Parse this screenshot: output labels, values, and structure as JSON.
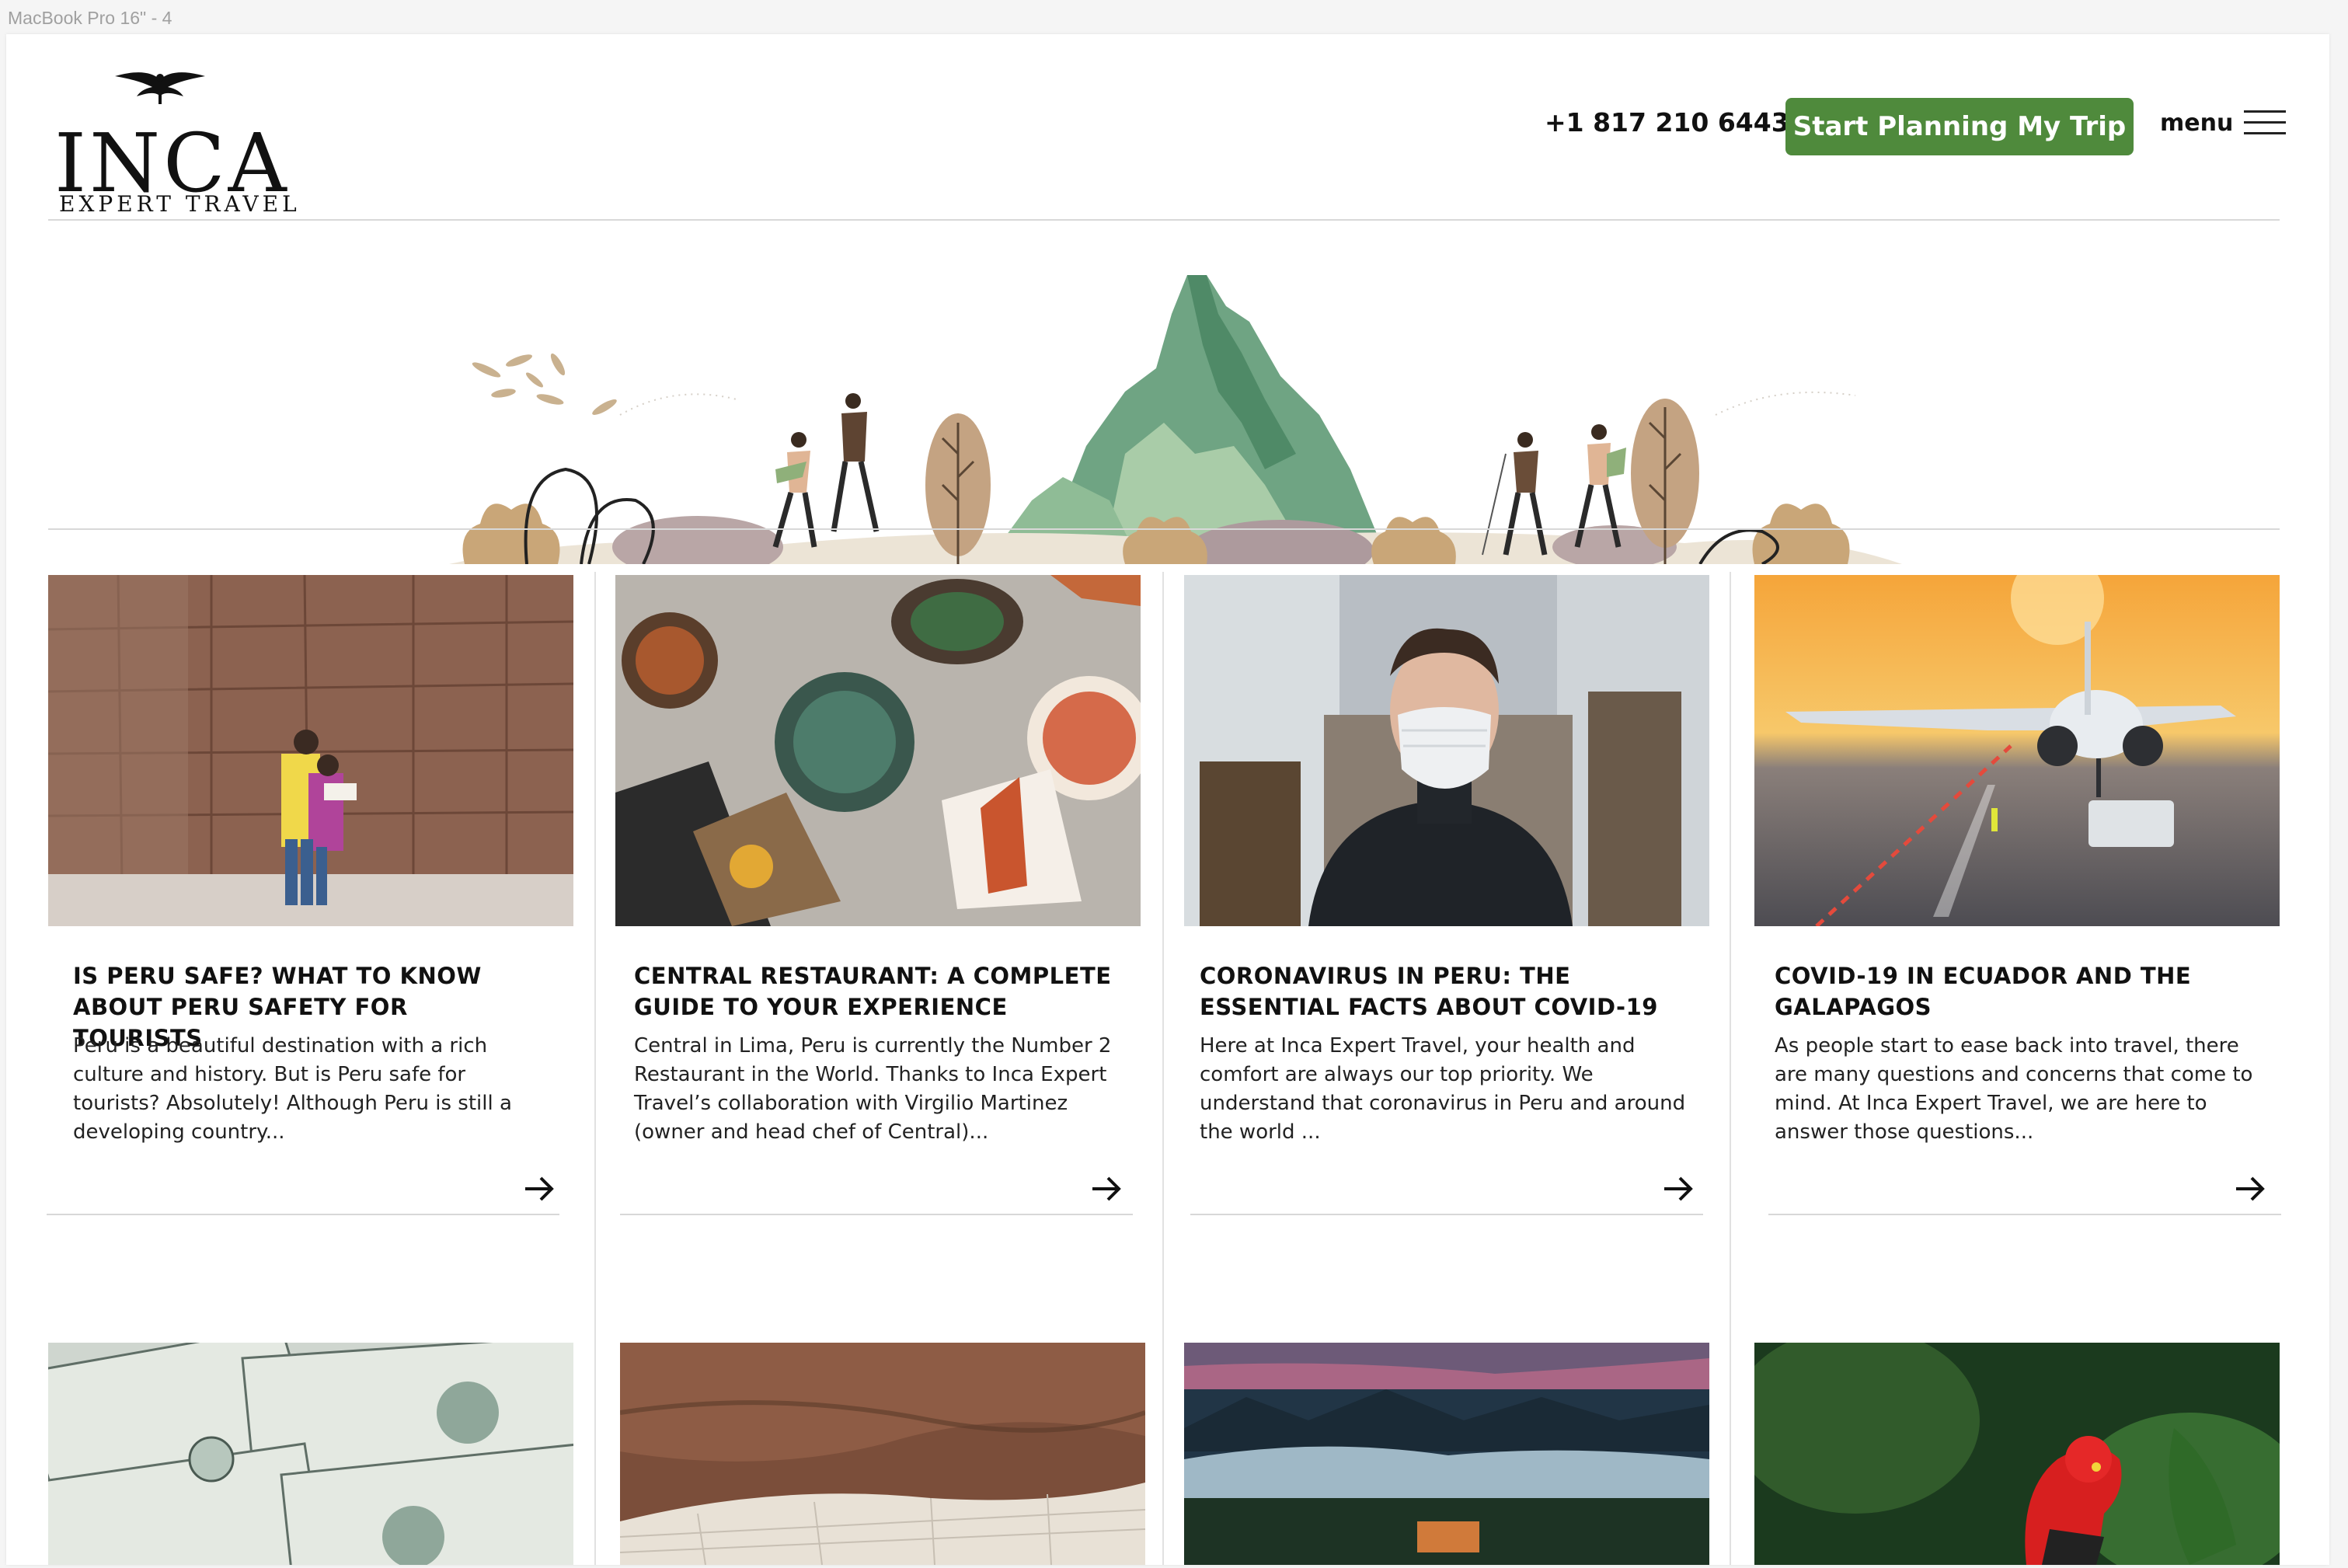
{
  "frame_label": "MacBook Pro 16\" - 4",
  "header": {
    "logo_word": "INCA",
    "logo_sub": "EXPERT TRAVEL",
    "phone": "+1 817 210 6443",
    "cta_label": "Start Planning My Trip",
    "menu_label": "menu"
  },
  "colors": {
    "brand_green": "#4f8a3c",
    "mountain_green": "#6fa483",
    "divider": "#d8d8d8"
  },
  "hero": {
    "illustration": "mountain-hikers-illustration"
  },
  "articles": [
    {
      "title": "IS PERU SAFE? WHAT TO KNOW ABOUT PERU SAFETY FOR TOURISTS",
      "excerpt": "Peru is a beautiful destination with a rich culture and history. But is Peru safe for tourists? Absolutely! Although Peru is still a developing country...",
      "image": "tourists-reading-map-by-inca-wall"
    },
    {
      "title": "CENTRAL RESTAURANT: A COMPLETE GUIDE TO YOUR EXPERIENCE",
      "excerpt": "Central in Lima, Peru is currently the Number 2 Restaurant in the World. Thanks to Inca Expert Travel’s collaboration with Virgilio Martinez (owner and head chef of Central)...",
      "image": "plated-dishes-on-stone-table"
    },
    {
      "title": "CORONAVIRUS IN PERU: THE ESSENTIAL FACTS ABOUT COVID-19",
      "excerpt": "Here at Inca Expert Travel, your health and comfort are always our top priority. We understand that coronavirus in Peru and around the world ...",
      "image": "man-wearing-face-mask"
    },
    {
      "title": "COVID-19 IN ECUADOR AND THE GALAPAGOS",
      "excerpt": "As people start to ease back into travel, there are many questions and concerns that come to mind. At Inca Expert Travel, we are here to answer those questions...",
      "image": "airplane-on-runway-at-sunset"
    }
  ],
  "bottom_images": [
    "us-dollar-bills",
    "salt-terraces-valley",
    "mountains-above-clouds",
    "cock-of-the-rock-bird"
  ]
}
